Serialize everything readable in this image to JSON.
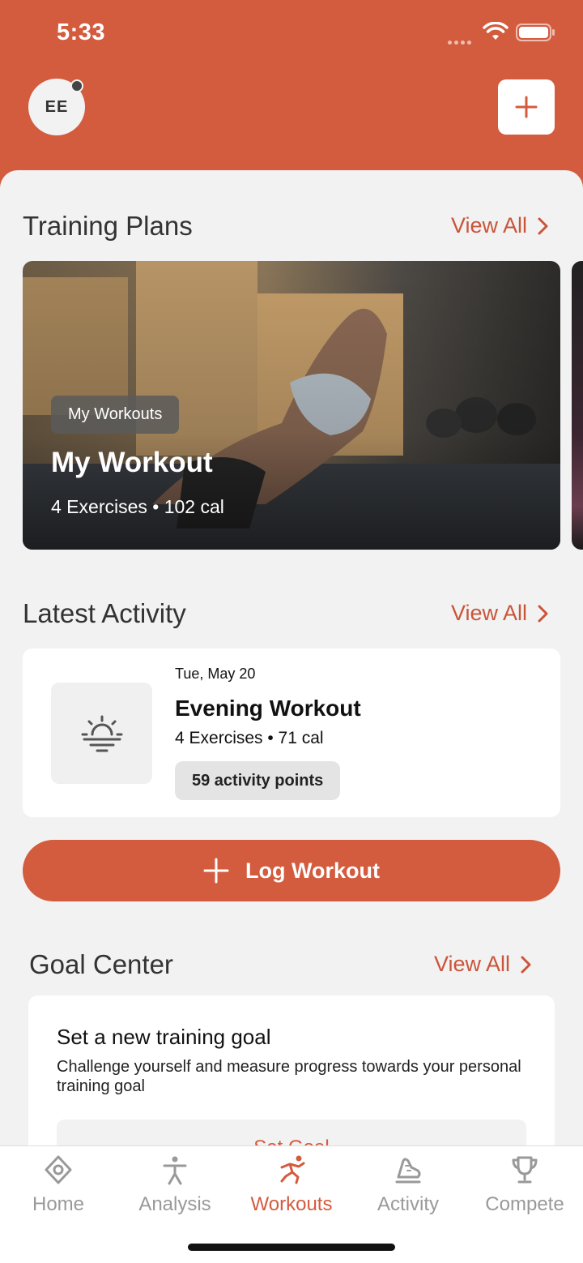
{
  "status_bar": {
    "time": "5:33"
  },
  "header": {
    "avatar_initials": "EE"
  },
  "training_plans": {
    "title": "Training Plans",
    "view_all": "View All",
    "card": {
      "tag": "My Workouts",
      "title": "My Workout",
      "meta": "4 Exercises • 102 cal"
    }
  },
  "latest_activity": {
    "title": "Latest Activity",
    "view_all": "View All",
    "item": {
      "date": "Tue, May 20",
      "title": "Evening Workout",
      "meta": "4 Exercises • 71 cal",
      "points": "59 activity points"
    }
  },
  "log_workout": {
    "label": "Log Workout"
  },
  "goal_center": {
    "title": "Goal Center",
    "view_all": "View All",
    "card": {
      "title": "Set a new training goal",
      "description": "Challenge yourself and measure progress towards your personal training goal",
      "button": "Set Goal"
    }
  },
  "tabs": [
    {
      "label": "Home",
      "icon": "home-icon"
    },
    {
      "label": "Analysis",
      "icon": "analysis-icon"
    },
    {
      "label": "Workouts",
      "icon": "workouts-icon",
      "active": true
    },
    {
      "label": "Activity",
      "icon": "activity-icon"
    },
    {
      "label": "Compete",
      "icon": "trophy-icon"
    }
  ],
  "colors": {
    "accent": "#d35b3e",
    "background": "#f2f2f2"
  }
}
